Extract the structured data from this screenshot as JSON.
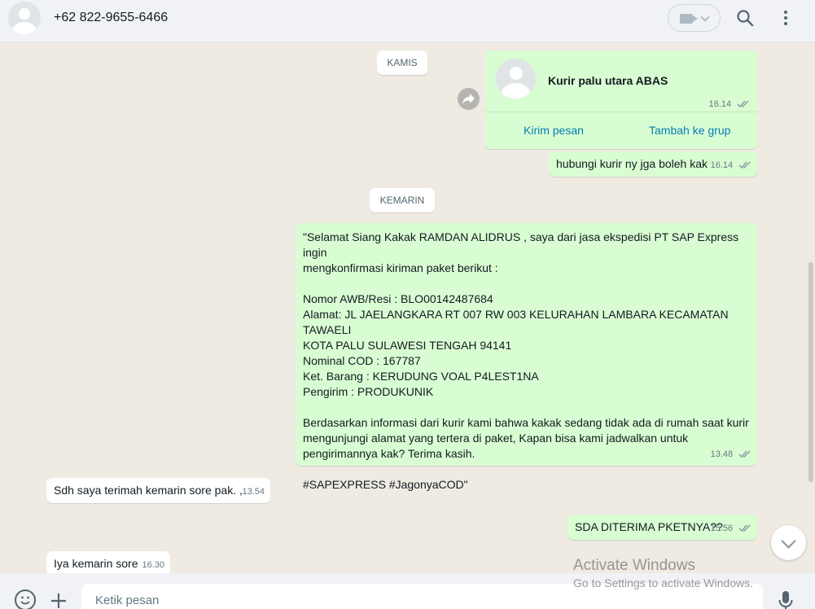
{
  "header": {
    "phone": "+62 822-9655-6466"
  },
  "chat": {
    "date_kamis": "KAMIS",
    "date_kemarin": "KEMARIN",
    "contact_card": {
      "name": "Kurir palu utara ABAS",
      "time": "16.14",
      "send_label": "Kirim pesan",
      "add_label": "Tambah ke grup"
    },
    "msg1": {
      "text": "hubungi kurir ny jga boleh kak",
      "time": "16.14"
    },
    "msg2": {
      "text": "\"Selamat Siang Kakak RAMDAN ALIDRUS , saya dari jasa ekspedisi PT SAP Express ingin\nmengkonfirmasi kiriman paket berikut :\n\nNomor AWB/Resi : BLO00142487684\nAlamat: JL JAELANGKARA RT 007 RW 003 KELURAHAN LAMBARA KECAMATAN TAWAELI\nKOTA PALU SULAWESI TENGAH 94141\nNominal COD : 167787\nKet. Barang : KERUDUNG VOAL P4LEST1NA\nPengirim : PRODUKUNIK\n\nBerdasarkan informasi dari kurir kami bahwa kakak sedang tidak ada di rumah saat kurir\nmengunjungi alamat yang tertera di paket, Kapan bisa kami jadwalkan untuk\npengirimannya kak? Terima kasih.\n\n#SAPEXPRESS #JagonyaCOD\"",
      "time": "13.48"
    },
    "msg3": {
      "text": "Sdh saya terimah kemarin sore pak. ,",
      "time": "13.54"
    },
    "msg4": {
      "text": "SDA DITERIMA PKETNYA??",
      "time": "15.56"
    },
    "msg5": {
      "text": "Iya kemarin sore",
      "time": "16.30"
    }
  },
  "input": {
    "placeholder": "Ketik pesan"
  },
  "watermark": {
    "title": "Activate Windows",
    "subtitle": "Go to Settings to activate Windows."
  },
  "colors": {
    "outgoing_bubble": "#d9fdd3",
    "incoming_bubble": "#ffffff",
    "chat_background": "#efeae2",
    "link_blue": "#027eb5",
    "read_ticks": "#53bdeb"
  },
  "icons": {
    "video_call": "video-camera-icon",
    "search": "search-icon",
    "menu": "kebab-menu-icon",
    "forward": "forward-arrow-icon",
    "emoji": "emoji-icon",
    "attach": "plus-icon",
    "mic": "microphone-icon",
    "scroll_down": "chevron-down-icon"
  }
}
